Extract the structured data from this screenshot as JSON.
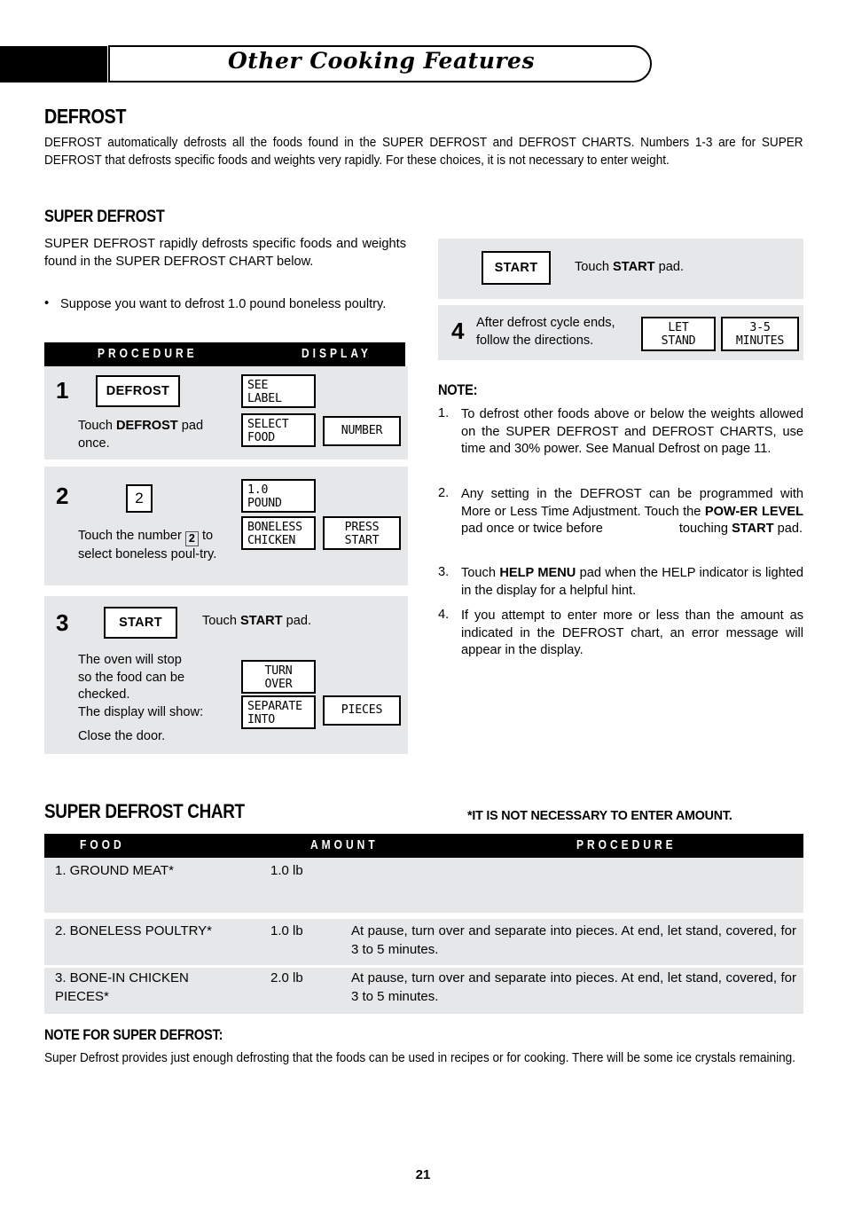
{
  "header": {
    "title": "Other Cooking Features"
  },
  "section": {
    "defrost_heading": "DEFROST",
    "defrost_intro": "DEFROST automatically defrosts all the foods found in the SUPER DEFROST and DEFROST CHARTS. Numbers 1-3 are for SUPER DEFROST that defrosts specific foods and weights very rapidly. For these choices, it is not necessary to enter weight.",
    "super_defrost_heading": "SUPER DEFROST",
    "super_defrost_intro": "SUPER DEFROST rapidly defrosts specific foods and  weights found in the SUPER DEFROST CHART below.",
    "bullet": "Suppose you want to defrost 1.0 pound boneless poultry.",
    "bullet_marker": "•"
  },
  "procedure_table": {
    "col_procedure": "PROCEDURE",
    "col_display": "DISPLAY",
    "steps": [
      {
        "number": "1",
        "pad_label": "DEFROST",
        "instruction_pre": "Touch ",
        "instruction_bold": "DEFROST",
        "instruction_post": " pad once.",
        "displays": [
          {
            "line1": "SEE",
            "line2": "LABEL"
          },
          {
            "line1": "SELECT",
            "line2": "FOOD"
          },
          {
            "line1": "NUMBER",
            "line2": ""
          }
        ]
      },
      {
        "number": "2",
        "pad_label": "2",
        "instruction_part1": "Touch the number ",
        "instruction_chip": "2",
        "instruction_part2": " to select boneless poul-try.",
        "displays": [
          {
            "line1": "1.0",
            "line2": "POUND"
          },
          {
            "line1": "BONELESS",
            "line2": "CHICKEN"
          },
          {
            "line1": "PRESS",
            "line2": "START"
          }
        ]
      },
      {
        "number": "3",
        "pad_label": "START",
        "instruction_pre": "Touch ",
        "instruction_bold": "START",
        "instruction_post": " pad.",
        "body_line1": "The oven will stop",
        "body_line2": "so the food can be",
        "body_line3": "checked.",
        "body_line4": "The display will show:",
        "body_line5": "Close the door.",
        "displays": [
          {
            "line1": "TURN",
            "line2": "OVER"
          },
          {
            "line1": "SEPARATE",
            "line2": "INTO"
          },
          {
            "line1": "PIECES",
            "line2": ""
          }
        ]
      },
      {
        "number": "",
        "pad_label": "START",
        "instruction_pre": "Touch ",
        "instruction_bold": "START",
        "instruction_post": " pad.",
        "displays": []
      },
      {
        "number": "4",
        "body_line1": "After defrost cycle ends,",
        "body_line2": "follow the directions.",
        "displays": [
          {
            "line1": "LET",
            "line2": "STAND"
          },
          {
            "line1": "3-5",
            "line2": "MINUTES"
          }
        ]
      }
    ]
  },
  "note": {
    "heading": "NOTE:",
    "items": [
      {
        "num": "1.",
        "text": "To defrost other foods above or below the weights allowed on the SUPER DEFROST and  DEFROST CHARTS, use time and 30% power. See Manual Defrost on page 11."
      },
      {
        "num": "2.",
        "t1": "Any setting in the DEFROST can be programmed with More or Less Time Adjustment. Touch the ",
        "b1": "POW-ER LEVEL",
        "t2": " pad once or twice before",
        "t3": "touching ",
        "b2": "START",
        "t4": " pad."
      },
      {
        "num": "3.",
        "t1": "Touch ",
        "b1": "HELP MENU",
        "t2": " pad when the HELP indicator is lighted in the display for a helpful hint."
      },
      {
        "num": "4.",
        "text": "If you attempt to enter more or less than the amount as indicated in the DEFROST chart, an error message will appear in the display."
      }
    ]
  },
  "chart": {
    "title": "SUPER DEFROST CHART",
    "star_note": "*IT IS NOT NECESSARY TO ENTER AMOUNT.",
    "columns": [
      "FOOD",
      "AMOUNT",
      "PROCEDURE"
    ],
    "rows": [
      {
        "food": "1. GROUND MEAT*",
        "amount": "1.0 lb",
        "procedure": ""
      },
      {
        "food": "2. BONELESS POULTRY*",
        "amount": "1.0 lb",
        "procedure": "At pause, turn over and separate into pieces. At end, let stand, covered, for 3 to 5 minutes."
      },
      {
        "food": "3. BONE-IN CHICKEN PIECES*",
        "amount": "2.0 lb",
        "procedure": "At pause, turn over and separate into pieces. At end, let stand, covered, for 3 to 5 minutes."
      }
    ]
  },
  "bottom_note": {
    "heading": "NOTE FOR SUPER DEFROST:",
    "text": "Super Defrost provides just enough defrosting that the foods can be used in recipes or for cooking. There will be some ice crystals remaining."
  },
  "page_number": "21"
}
